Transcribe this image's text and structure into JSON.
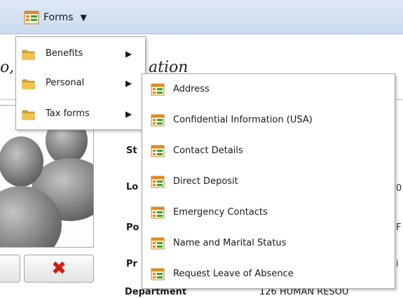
{
  "toolbar": {
    "forms_label": "Forms",
    "forms_icon": "forms-grid-icon",
    "caret_icon": "triangle-down-icon"
  },
  "background": {
    "title_left": "o,",
    "title_right": "ation",
    "field_labels": [
      "St",
      "Lo",
      "Po",
      "Pr"
    ],
    "department_label": "Department",
    "department_value": "126 HUMAN RESOU",
    "right_clips": [
      "0",
      "F",
      "i"
    ]
  },
  "menu_main": {
    "items": [
      {
        "label": "Benefits",
        "icon": "folder-icon"
      },
      {
        "label": "Personal",
        "icon": "folder-icon"
      },
      {
        "label": "Tax forms",
        "icon": "folder-icon"
      }
    ]
  },
  "menu_personal": {
    "items": [
      {
        "label": "Address"
      },
      {
        "label": "Confidential Information (USA)"
      },
      {
        "label": "Contact Details"
      },
      {
        "label": "Direct Deposit"
      },
      {
        "label": "Emergency Contacts"
      },
      {
        "label": "Name and Marital Status"
      },
      {
        "label": "Request Leave of Absence"
      }
    ]
  },
  "colors": {
    "toolbar_top": "#dfe9f6",
    "toolbar_bottom": "#cadbef",
    "folder": "#f2c44a",
    "form_icon_green": "#3aa13a",
    "form_icon_orange": "#e08a1e",
    "delete_red": "#d21b0f"
  }
}
